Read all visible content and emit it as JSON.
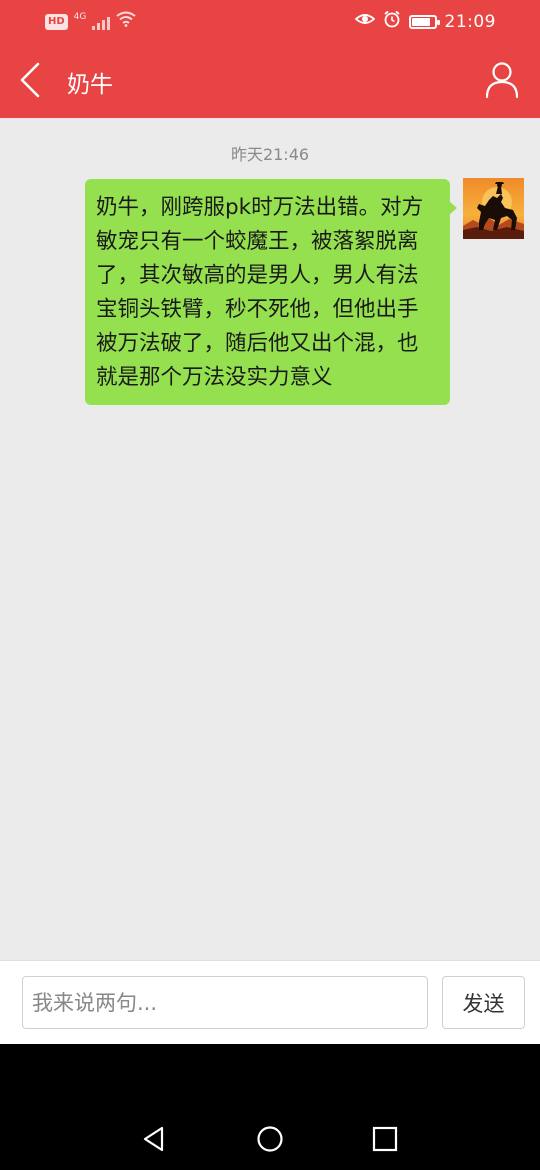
{
  "status_bar": {
    "hd_label": "HD",
    "network_label": "4G",
    "time": "21:09",
    "battery_level": 0.85,
    "icons": [
      "eye-comfort-icon",
      "alarm-icon",
      "battery-icon",
      "wifi-icon",
      "signal-icon"
    ]
  },
  "header": {
    "title": "奶牛",
    "back_icon": "chevron-left-icon",
    "profile_icon": "user-profile-icon",
    "background_color": "#e84444"
  },
  "chat": {
    "timestamp": "昨天21:46",
    "messages": [
      {
        "sender": "self",
        "text": "奶牛，刚跨服pk时万法出错。对方敏宠只有一个蛟魔王，被落絮脱离了，其次敏高的是男人，男人有法宝铜头铁臂，秒不死他，但他出手被万法破了，随后他又出个混，也就是那个万法没实力意义",
        "bubble_color": "#95e04f"
      }
    ]
  },
  "input_bar": {
    "placeholder": "我来说两句...",
    "value": "",
    "send_label": "发送"
  },
  "system_nav": {
    "icons": [
      "back-triangle-icon",
      "home-circle-icon",
      "recents-square-icon"
    ]
  }
}
